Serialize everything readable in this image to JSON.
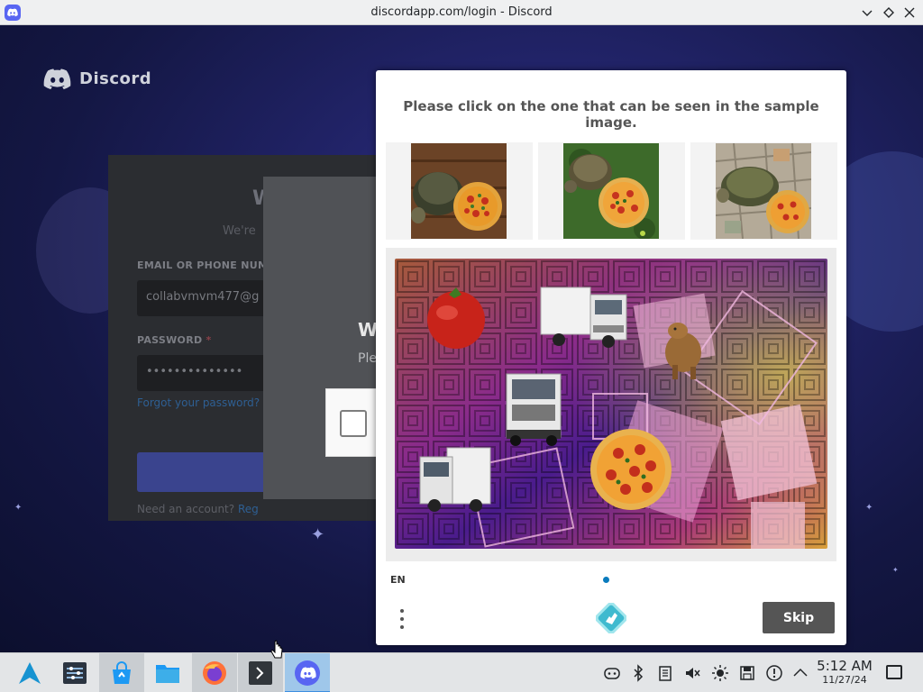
{
  "window": {
    "title": "discordapp.com/login - Discord"
  },
  "background": {
    "logo_text": "Discord",
    "login": {
      "welcome": "W",
      "subtitle": "We're",
      "email_label": "EMAIL OR PHONE NUMB",
      "email_value": "collabvmvm477@g",
      "password_label": "PASSWORD",
      "password_required": "*",
      "password_value": "••••••••••••••",
      "forgot_link": "Forgot your password?",
      "need_account": "Need an account?",
      "register_link": "Reg"
    },
    "modal": {
      "title": "W",
      "text": "Ple"
    }
  },
  "captcha": {
    "prompt": "Please click on the one that can be seen in the sample image.",
    "samples": [
      {
        "name": "tortoise-and-pizza-on-wood"
      },
      {
        "name": "tortoise-and-pizza-on-grass"
      },
      {
        "name": "tortoise-and-pizza-on-tiles"
      }
    ],
    "language": "EN",
    "skip_label": "Skip"
  },
  "taskbar": {
    "apps": [
      "app-launcher",
      "system-settings",
      "discover-store",
      "file-manager",
      "firefox",
      "terminal",
      "discord"
    ],
    "tray_icons": [
      "discord-tray-icon",
      "bluetooth-icon",
      "clipboard-icon",
      "volume-muted-icon",
      "brightness-icon",
      "save-icon",
      "network-icon",
      "chevron-up-icon"
    ],
    "time": "5:12 AM",
    "date": "11/27/24"
  },
  "colors": {
    "discord_blurple": "#5865f2",
    "skip_button": "#555555",
    "dot": "#0a7bbd"
  }
}
